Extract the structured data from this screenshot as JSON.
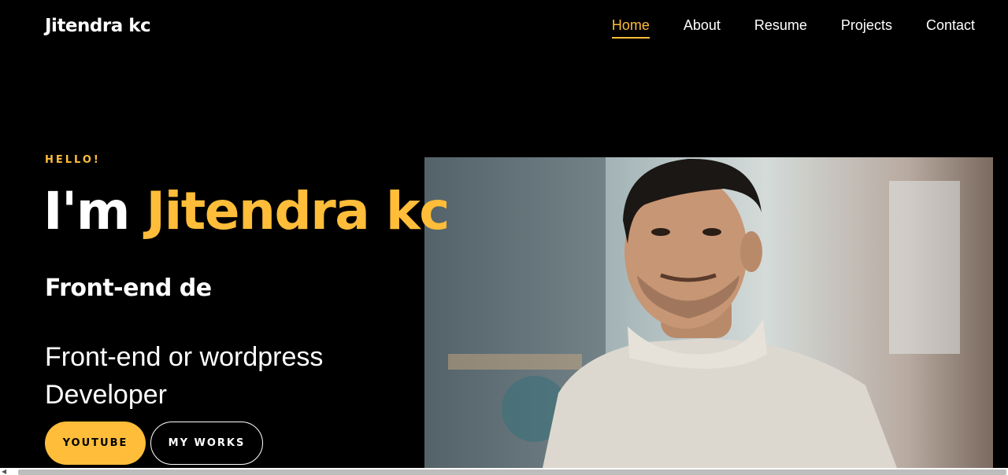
{
  "brand": {
    "name": "Jitendra kc"
  },
  "nav": {
    "items": [
      {
        "label": "Home",
        "active": true
      },
      {
        "label": "About",
        "active": false
      },
      {
        "label": "Resume",
        "active": false
      },
      {
        "label": "Projects",
        "active": false
      },
      {
        "label": "Contact",
        "active": false
      }
    ]
  },
  "hero": {
    "greeting": "HELLO!",
    "headline_prefix": "I'm",
    "headline_name": "Jitendra kc",
    "typed_text": "Front-end de",
    "role": "Front-end or wordpress Developer",
    "buttons": {
      "youtube": "YOUTUBE",
      "works": "MY WORKS"
    }
  },
  "colors": {
    "accent": "#ffbd39",
    "background": "#000000",
    "text": "#ffffff"
  },
  "icons": {
    "scroll_left": "chevron-left-icon"
  }
}
